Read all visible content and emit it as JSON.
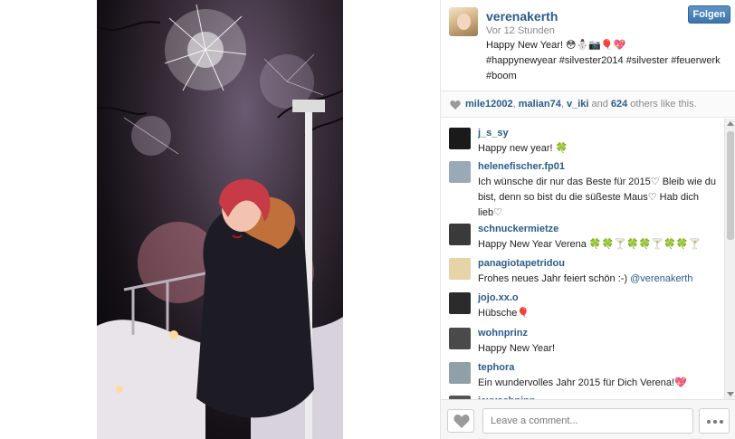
{
  "post": {
    "username": "verenakerth",
    "time_ago": "Vor 12 Stunden",
    "follow_label": "Folgen",
    "caption_line1": "Happy New Year! 😳⛄📷🎈💖",
    "caption_line2": "#happynewyear #silvester2014 #silvester #feuerwerk #boom"
  },
  "likes": {
    "user1": "mile12002",
    "sep1": ", ",
    "user2": "malian74",
    "sep2": ", ",
    "user3": "v_iki",
    "middle": " and ",
    "count": "624",
    "tail": " others like this."
  },
  "comments": [
    {
      "user": "j_s_sy",
      "text": "Happy new year! 🍀",
      "avatar_color": "#1a1a1a"
    },
    {
      "user": "helenefischer.fp01",
      "text": "Ich wünsche dir nur das Beste für 2015♡ Bleib wie du bist, denn so bist du die süßeste Maus♡ Hab dich lieb♡",
      "avatar_color": "#9aa9b8"
    },
    {
      "user": "schnuckermietze",
      "text": "Happy New Year Verena 🍀🍀🍸🍀🍀🍸🍀🍀🍸",
      "avatar_color": "#3a3a3a"
    },
    {
      "user": "panagiotapetridou",
      "text": "Frohes neues Jahr feiert schön :-) ",
      "mention": "@verenakerth",
      "avatar_color": "#e6d3a8"
    },
    {
      "user": "jojo.xx.o",
      "text": "Hübsche🎈",
      "avatar_color": "#2b2b2b"
    },
    {
      "user": "wohnprinz",
      "text": "Happy New Year!",
      "avatar_color": "#4a4a4a"
    },
    {
      "user": "tephora",
      "text": "Ein wundervolles Jahr 2015 für Dich Verena!💖",
      "avatar_color": "#8fa0a8"
    },
    {
      "user": "jeyyschnipp",
      "text": "",
      "avatar_color": "#555555"
    }
  ],
  "footer": {
    "comment_placeholder": "Leave a comment..."
  },
  "colors": {
    "link": "#2a5b8b",
    "follow_button": "#3c76ae"
  }
}
